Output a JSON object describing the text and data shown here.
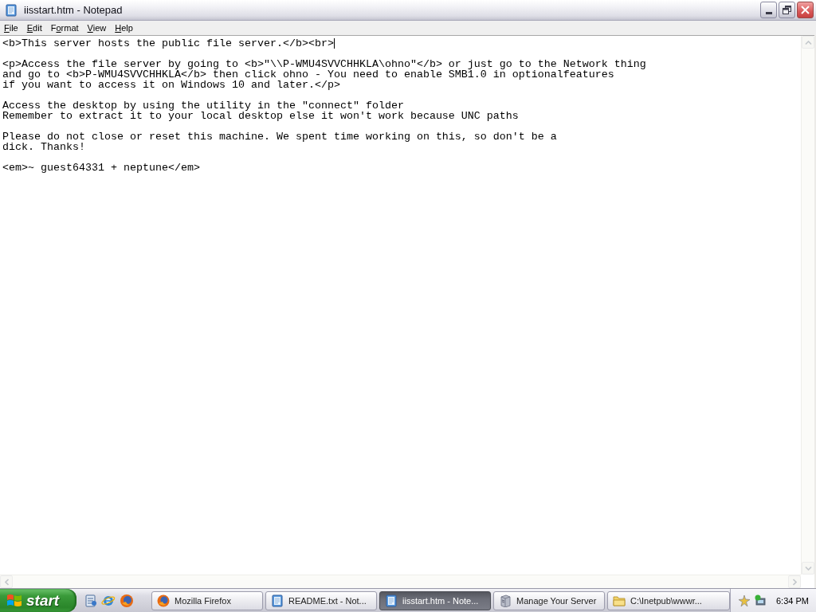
{
  "window": {
    "title": "iisstart.htm - Notepad"
  },
  "menu": [
    {
      "key": "F",
      "after": "ile"
    },
    {
      "key": "E",
      "after": "dit"
    },
    {
      "before": "F",
      "key": "o",
      "after": "rmat"
    },
    {
      "key": "V",
      "after": "iew"
    },
    {
      "key": "H",
      "after": "elp"
    }
  ],
  "editor": {
    "paragraphs": [
      {
        "lines": [
          {
            "text": "<b>This server hosts the public file server.</b><br>",
            "caret": true
          }
        ]
      },
      {
        "lines": [
          {
            "text": "<p>Access the file server by going to <b>\"\\\\P-WMU4SVVCHHKLA\\ohno\"</b> or just go to the Network thing",
            "caret": false
          },
          {
            "text": "and go to <b>P-WMU4SVVCHHKLA</b> then click ohno - You need to enable SMB1.0 in optionalfeatures",
            "caret": false
          },
          {
            "text": "if you want to access it on Windows 10 and later.</p>",
            "caret": false
          }
        ]
      },
      {
        "lines": [
          {
            "text": "Access the desktop by using the utility in the \"connect\" folder",
            "caret": false
          },
          {
            "text": "Remember to extract it to your local desktop else it won't work because UNC paths",
            "caret": false
          }
        ]
      },
      {
        "lines": [
          {
            "text": "Please do not close or reset this machine. We spent time working on this, so don't be a",
            "caret": false
          },
          {
            "text": "dick. Thanks!",
            "caret": false
          }
        ]
      },
      {
        "lines": [
          {
            "text": "<em>~ guest64331 + neptune</em>",
            "caret": false
          }
        ]
      }
    ]
  },
  "taskbar": {
    "start": "start",
    "buttons": [
      {
        "label": "Mozilla Firefox",
        "kind": "browser",
        "selected": false
      },
      {
        "label": "README.txt - Not...",
        "kind": "notepad",
        "selected": false
      },
      {
        "label": "iisstart.htm - Note...",
        "kind": "notepad",
        "selected": true
      },
      {
        "label": "Manage Your Server",
        "kind": "server",
        "selected": false
      },
      {
        "label": "C:\\Inetpub\\wwwr...",
        "kind": "folder",
        "selected": false
      }
    ],
    "clock": "6:34 PM"
  }
}
